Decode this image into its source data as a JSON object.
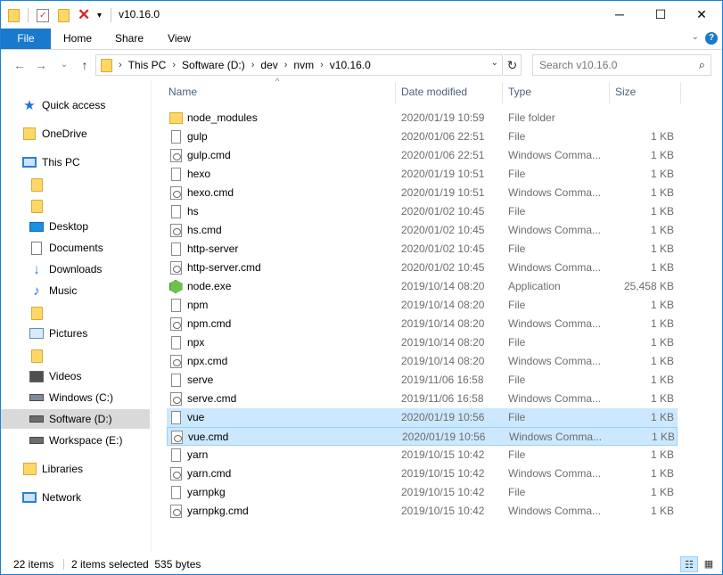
{
  "window": {
    "title": "v10.16.0",
    "minimize_glyph": "─",
    "maximize_glyph": "☐",
    "close_glyph": "✕"
  },
  "quick_access_toolbar": {
    "icons": [
      "folder-icon",
      "properties-icon",
      "new-folder-icon",
      "delete-icon",
      "customize-dropdown-icon"
    ]
  },
  "ribbon": {
    "tabs": [
      {
        "label": "File",
        "active": true
      },
      {
        "label": "Home"
      },
      {
        "label": "Share"
      },
      {
        "label": "View"
      }
    ],
    "expand_glyph": "⌄",
    "help_glyph": "?"
  },
  "address_bar": {
    "breadcrumbs": [
      "This PC",
      "Software (D:)",
      "dev",
      "nvm",
      "v10.16.0"
    ],
    "back_glyph": "←",
    "forward_glyph": "→",
    "recent_glyph": "⌄",
    "up_glyph": "↑",
    "refresh_glyph": "↻",
    "dropdown_glyph": "⌄"
  },
  "search": {
    "placeholder": "Search v10.16.0",
    "icon_glyph": "⌕"
  },
  "nav_pane": {
    "items": [
      {
        "label": "Quick access",
        "icon": "star-icon"
      },
      {
        "label": "OneDrive",
        "icon": "onedrive-icon"
      },
      {
        "label": "This PC",
        "icon": "computer-icon"
      },
      {
        "label": "",
        "icon": "folder-icon"
      },
      {
        "label": "",
        "icon": "folder-icon"
      },
      {
        "label": "Desktop",
        "icon": "desktop-icon"
      },
      {
        "label": "Documents",
        "icon": "documents-icon"
      },
      {
        "label": "Downloads",
        "icon": "download-icon"
      },
      {
        "label": "Music",
        "icon": "music-icon"
      },
      {
        "label": "",
        "icon": "folder-icon"
      },
      {
        "label": "Pictures",
        "icon": "pictures-icon"
      },
      {
        "label": "",
        "icon": "folder-icon"
      },
      {
        "label": "Videos",
        "icon": "videos-icon"
      },
      {
        "label": "Windows (C:)",
        "icon": "drive-icon"
      },
      {
        "label": "Software (D:)",
        "icon": "drive-icon",
        "selected": true
      },
      {
        "label": "Workspace (E:)",
        "icon": "drive-icon"
      },
      {
        "label": "Libraries",
        "icon": "libraries-icon"
      },
      {
        "label": "Network",
        "icon": "network-icon"
      }
    ]
  },
  "columns": {
    "name": "Name",
    "date": "Date modified",
    "type": "Type",
    "size": "Size",
    "sort_glyph": "^"
  },
  "files": [
    {
      "name": "node_modules",
      "date": "2020/01/19 10:59",
      "type": "File folder",
      "size": "",
      "icon": "folder"
    },
    {
      "name": "gulp",
      "date": "2020/01/06 22:51",
      "type": "File",
      "size": "1 KB",
      "icon": "file"
    },
    {
      "name": "gulp.cmd",
      "date": "2020/01/06 22:51",
      "type": "Windows Comma...",
      "size": "1 KB",
      "icon": "cmd"
    },
    {
      "name": "hexo",
      "date": "2020/01/19 10:51",
      "type": "File",
      "size": "1 KB",
      "icon": "file"
    },
    {
      "name": "hexo.cmd",
      "date": "2020/01/19 10:51",
      "type": "Windows Comma...",
      "size": "1 KB",
      "icon": "cmd"
    },
    {
      "name": "hs",
      "date": "2020/01/02 10:45",
      "type": "File",
      "size": "1 KB",
      "icon": "file"
    },
    {
      "name": "hs.cmd",
      "date": "2020/01/02 10:45",
      "type": "Windows Comma...",
      "size": "1 KB",
      "icon": "cmd"
    },
    {
      "name": "http-server",
      "date": "2020/01/02 10:45",
      "type": "File",
      "size": "1 KB",
      "icon": "file"
    },
    {
      "name": "http-server.cmd",
      "date": "2020/01/02 10:45",
      "type": "Windows Comma...",
      "size": "1 KB",
      "icon": "cmd"
    },
    {
      "name": "node.exe",
      "date": "2019/10/14 08:20",
      "type": "Application",
      "size": "25,458 KB",
      "icon": "app"
    },
    {
      "name": "npm",
      "date": "2019/10/14 08:20",
      "type": "File",
      "size": "1 KB",
      "icon": "file"
    },
    {
      "name": "npm.cmd",
      "date": "2019/10/14 08:20",
      "type": "Windows Comma...",
      "size": "1 KB",
      "icon": "cmd"
    },
    {
      "name": "npx",
      "date": "2019/10/14 08:20",
      "type": "File",
      "size": "1 KB",
      "icon": "file"
    },
    {
      "name": "npx.cmd",
      "date": "2019/10/14 08:20",
      "type": "Windows Comma...",
      "size": "1 KB",
      "icon": "cmd"
    },
    {
      "name": "serve",
      "date": "2019/11/06 16:58",
      "type": "File",
      "size": "1 KB",
      "icon": "file"
    },
    {
      "name": "serve.cmd",
      "date": "2019/11/06 16:58",
      "type": "Windows Comma...",
      "size": "1 KB",
      "icon": "cmd"
    },
    {
      "name": "vue",
      "date": "2020/01/19 10:56",
      "type": "File",
      "size": "1 KB",
      "icon": "file",
      "selected": true
    },
    {
      "name": "vue.cmd",
      "date": "2020/01/19 10:56",
      "type": "Windows Comma...",
      "size": "1 KB",
      "icon": "cmd",
      "selected": true,
      "focused": true
    },
    {
      "name": "yarn",
      "date": "2019/10/15 10:42",
      "type": "File",
      "size": "1 KB",
      "icon": "file"
    },
    {
      "name": "yarn.cmd",
      "date": "2019/10/15 10:42",
      "type": "Windows Comma...",
      "size": "1 KB",
      "icon": "cmd"
    },
    {
      "name": "yarnpkg",
      "date": "2019/10/15 10:42",
      "type": "File",
      "size": "1 KB",
      "icon": "file"
    },
    {
      "name": "yarnpkg.cmd",
      "date": "2019/10/15 10:42",
      "type": "Windows Comma...",
      "size": "1 KB",
      "icon": "cmd"
    }
  ],
  "status": {
    "item_count": "22 items",
    "selection": "2 items selected  535 bytes",
    "details_view_glyph": "☷",
    "large_icons_glyph": "▦"
  },
  "colors": {
    "accent": "#1979ca",
    "selection": "#cce8ff",
    "selection_border": "#99d1ff",
    "nav_selected": "#d9d9d9"
  }
}
